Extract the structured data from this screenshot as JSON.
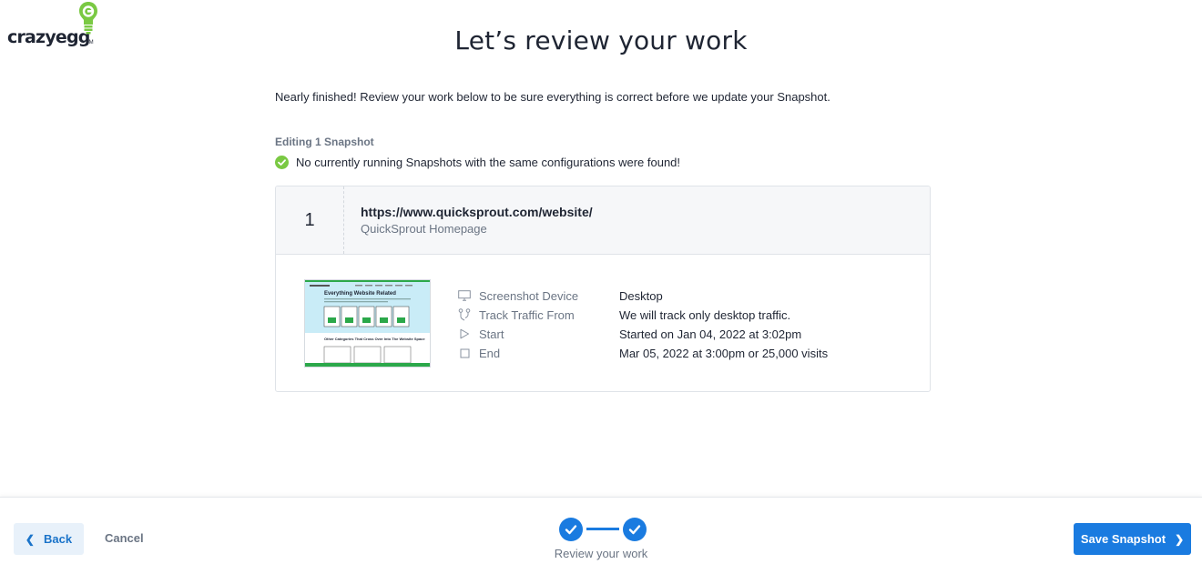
{
  "logo": {
    "text": "crazyegg",
    "tm": "TM",
    "icon": "lightbulb-logo-icon",
    "color": "#7ac943"
  },
  "page": {
    "title": "Let’s review your work",
    "intro": "Nearly finished! Review your work below to be sure everything is correct before we update your Snapshot.",
    "editing_label": "Editing 1 Snapshot",
    "status_message": "No currently running Snapshots with the same configurations were found!",
    "status_icon": "check-circle-icon",
    "status_color": "#7ac943"
  },
  "snapshot": {
    "index": "1",
    "url": "https://www.quicksprout.com/website/",
    "name": "QuickSprout Homepage",
    "thumbnail": {
      "heading": "Everything Website Related",
      "subheading": "Other Categories That Cross Over Into The Website Space"
    },
    "details": [
      {
        "icon": "monitor-icon",
        "label": "Screenshot Device",
        "value": "Desktop"
      },
      {
        "icon": "traffic-split-icon",
        "label": "Track Traffic From",
        "value": "We will track only desktop traffic."
      },
      {
        "icon": "play-icon",
        "label": "Start",
        "value": "Started on Jan 04, 2022 at 3:02pm"
      },
      {
        "icon": "stop-icon",
        "label": "End",
        "value": "Mar 05, 2022 at 3:00pm or 25,000 visits"
      }
    ]
  },
  "footer": {
    "back_label": "Back",
    "cancel_label": "Cancel",
    "step_label": "Review your work",
    "save_label": "Save Snapshot",
    "accent": "#1a7be0"
  }
}
